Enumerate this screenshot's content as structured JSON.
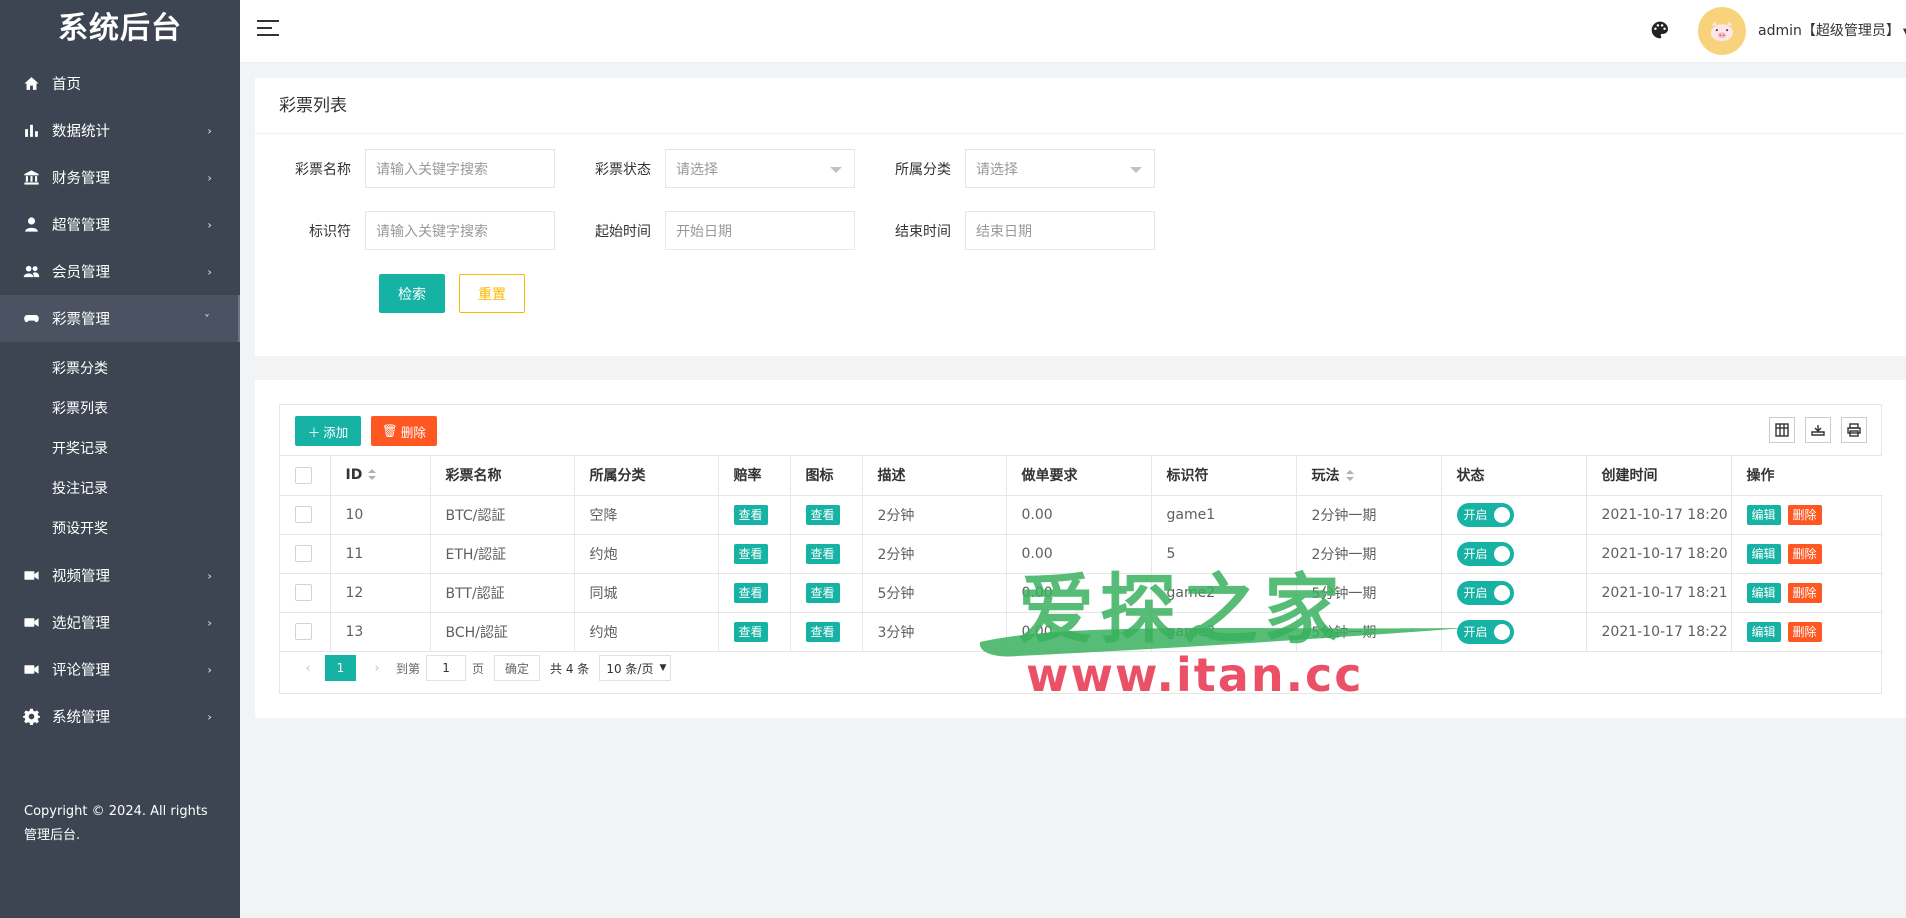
{
  "app": {
    "title": "系统后台"
  },
  "sidebar": {
    "items": [
      {
        "label": "首页",
        "icon": "home-icon",
        "has_arrow": false
      },
      {
        "label": "数据统计",
        "icon": "bar-chart-icon",
        "has_arrow": true
      },
      {
        "label": "财务管理",
        "icon": "bank-icon",
        "has_arrow": true
      },
      {
        "label": "超管管理",
        "icon": "user-icon",
        "has_arrow": true
      },
      {
        "label": "会员管理",
        "icon": "users-icon",
        "has_arrow": true
      },
      {
        "label": "彩票管理",
        "icon": "gamepad-icon",
        "has_arrow": true,
        "expanded": true
      },
      {
        "label": "视频管理",
        "icon": "video-icon",
        "has_arrow": true
      },
      {
        "label": "选妃管理",
        "icon": "video-icon",
        "has_arrow": true
      },
      {
        "label": "评论管理",
        "icon": "video-icon",
        "has_arrow": true
      },
      {
        "label": "系统管理",
        "icon": "gear-icon",
        "has_arrow": true
      }
    ],
    "submenu": [
      "彩票分类",
      "彩票列表",
      "开奖记录",
      "投注记录",
      "预设开奖"
    ],
    "copyright": "Copyright © 2024. All rights 管理后台."
  },
  "header": {
    "user": "admin【超级管理员】"
  },
  "search": {
    "title": "彩票列表",
    "fields": {
      "name": {
        "label": "彩票名称",
        "placeholder": "请输入关键字搜索"
      },
      "status": {
        "label": "彩票状态",
        "placeholder": "请选择"
      },
      "category": {
        "label": "所属分类",
        "placeholder": "请选择"
      },
      "key": {
        "label": "标识符",
        "placeholder": "请输入关键字搜索"
      },
      "start": {
        "label": "起始时间",
        "placeholder": "开始日期"
      },
      "end": {
        "label": "结束时间",
        "placeholder": "结束日期"
      }
    },
    "search_btn": "检索",
    "reset_btn": "重置"
  },
  "table": {
    "add_btn": "添加",
    "del_btn": "删除",
    "columns": [
      "ID",
      "彩票名称",
      "所属分类",
      "赔率",
      "图标",
      "描述",
      "做单要求",
      "标识符",
      "玩法",
      "状态",
      "创建时间",
      "操作"
    ],
    "view_label": "查看",
    "edit_label": "编辑",
    "delete_label": "删除",
    "switch_label": "开启",
    "rows": [
      {
        "id": "10",
        "name": "BTC/認証",
        "category": "空降",
        "desc": "2分钟",
        "req": "0.00",
        "key": "game1",
        "play": "2分钟一期",
        "created": "2021-10-17 18:20"
      },
      {
        "id": "11",
        "name": "ETH/認証",
        "category": "约炮",
        "desc": "2分钟",
        "req": "0.00",
        "key": "5",
        "play": "2分钟一期",
        "created": "2021-10-17 18:20"
      },
      {
        "id": "12",
        "name": "BTT/認証",
        "category": "同城",
        "desc": "5分钟",
        "req": "0.00",
        "key": "game2",
        "play": "5分钟一期",
        "created": "2021-10-17 18:21"
      },
      {
        "id": "13",
        "name": "BCH/認証",
        "category": "约炮",
        "desc": "3分钟",
        "req": "0.00",
        "key": "game3",
        "play": "5分钟一期",
        "created": "2021-10-17 18:22"
      }
    ]
  },
  "pager": {
    "current": "1",
    "goto_label": "到第",
    "page_input": "1",
    "page_unit": "页",
    "confirm": "确定",
    "total": "共 4 条",
    "page_size": "10 条/页"
  },
  "watermark": {
    "cn": "爱探之家",
    "url": "www.itan.cc"
  },
  "colors": {
    "sidebar": "#3d4553",
    "accent": "#16b2a4",
    "danger": "#ff5722",
    "warn": "#ffb800"
  }
}
